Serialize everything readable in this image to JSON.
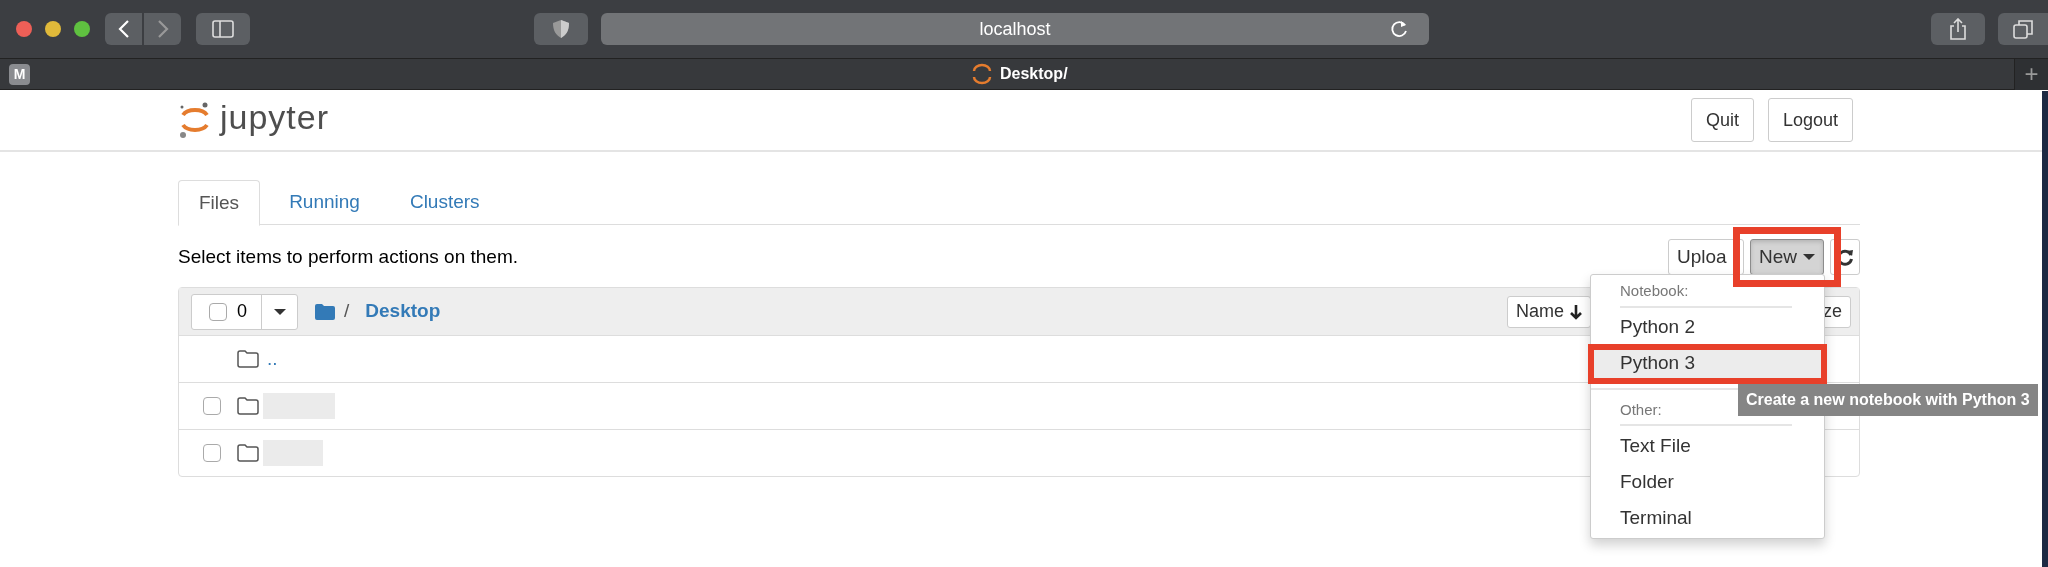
{
  "browser": {
    "address": "localhost",
    "pinned_tab": "M",
    "tab_title": "Desktop/",
    "new_tab": "+"
  },
  "header": {
    "logo_text": "jupyter",
    "buttons": [
      "Quit",
      "Logout"
    ]
  },
  "tabs": [
    {
      "label": "Files",
      "selected": true
    },
    {
      "label": "Running",
      "selected": false
    },
    {
      "label": "Clusters",
      "selected": false
    }
  ],
  "instructions": "Select items to perform actions on them.",
  "toolbar": [
    {
      "label": "Uploa",
      "pressed": false,
      "highlighted": false
    },
    {
      "label": "New",
      "pressed": true,
      "highlighted": true
    }
  ],
  "list": {
    "select_all": {
      "checked": false,
      "count": "0"
    },
    "separator": "/",
    "breadcrumb": "Desktop",
    "sort_button": "Name",
    "column_2": "ze",
    "rows": [
      {
        "kind": "parent",
        "name": ".."
      },
      {
        "kind": "redacted",
        "checked": false
      },
      {
        "kind": "redacted",
        "checked": false
      }
    ]
  },
  "menu": [
    {
      "header": "Notebook:",
      "items": [
        {
          "label": "Python 2",
          "selected": false,
          "highlighted": false
        },
        {
          "label": "Python 3",
          "selected": true,
          "highlighted": true
        }
      ]
    },
    {
      "header": "Other:",
      "items": [
        {
          "label": "Text File",
          "selected": false,
          "highlighted": false
        },
        {
          "label": "Folder",
          "selected": false,
          "highlighted": false
        },
        {
          "label": "Terminal",
          "selected": false,
          "highlighted": false
        }
      ]
    }
  ],
  "tooltip": "Create a new notebook with Python 3"
}
